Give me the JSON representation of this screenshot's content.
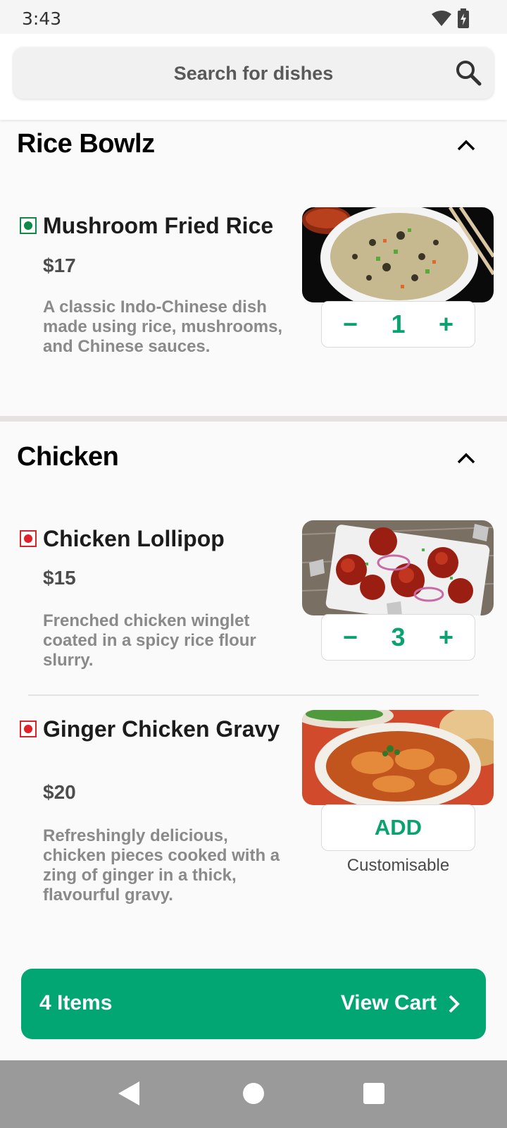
{
  "status_bar": {
    "time": "3:43"
  },
  "search": {
    "placeholder": "Search for dishes"
  },
  "sections": [
    {
      "title": "Rice Bowlz",
      "items": [
        {
          "type": "veg",
          "name": "Mushroom Fried Rice",
          "price": "$17",
          "description": "A classic Indo-Chinese dish made using rice, mushrooms, and Chinese sauces.",
          "quantity": "1",
          "image": "mushroom-fried-rice-image"
        }
      ]
    },
    {
      "title": "Chicken",
      "items": [
        {
          "type": "non-veg",
          "name": "Chicken Lollipop",
          "price": "$15",
          "description": "Frenched chicken winglet coated in a spicy rice flour slurry.",
          "quantity": "3",
          "image": "chicken-lollipop-image"
        },
        {
          "type": "non-veg",
          "name": "Ginger Chicken Gravy",
          "price": "$20",
          "description": "Refreshingly delicious, chicken pieces cooked with a zing of ginger in a thick, flavourful gravy.",
          "add_label": "ADD",
          "note": "Customisable",
          "image": "ginger-chicken-gravy-image"
        }
      ]
    }
  ],
  "stepper": {
    "minus": "−",
    "plus": "+"
  },
  "cart": {
    "items_label": "4 Items",
    "view_label": "View Cart"
  },
  "colors": {
    "accent": "#02a672",
    "veg": "#0d8a4a",
    "nonveg": "#e0202a"
  }
}
